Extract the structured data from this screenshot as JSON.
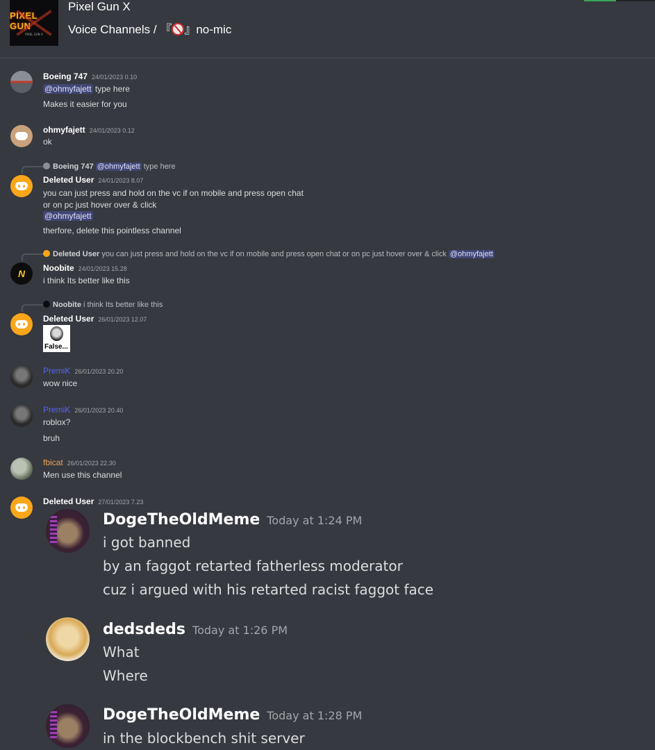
{
  "header": {
    "server_name": "Pixel Gun X",
    "breadcrumb_category": "Voice Channels /",
    "channel_prefix": "『",
    "channel_suffix": "』no-mic",
    "server_icon_text": "PIXEL GUN",
    "server_icon_subtext": "PIXEL GUN X"
  },
  "messages": [
    {
      "author": "Boeing 747",
      "timestamp": "24/01/2023 0.10",
      "mention": "@ohmyfajett",
      "line1_rest": " type here",
      "line2": "Makes it easier for you"
    },
    {
      "author": "ohmyfajett",
      "timestamp": "24/01/2023 0.12",
      "line1": "ok"
    },
    {
      "reply_author": "Boeing 747",
      "reply_mention": "@ohmyfajett",
      "reply_text": " type here",
      "author": "Deleted User",
      "timestamp": "24/01/2023 8.07",
      "line1": "you can just press and hold on the vc if on mobile and press open chat",
      "line2": "or on pc just hover over & click",
      "mention": "@ohmyfajett",
      "line3": "therfore, delete this pointless channel"
    },
    {
      "reply_author": "Deleted User",
      "reply_text": " you can just press and hold on the vc if on mobile and press open chat or on pc just hover over & click ",
      "reply_mention": "@ohmyfajett",
      "author": "Noobite",
      "timestamp": "24/01/2023 15.28",
      "line1": "i think Its better like this",
      "avatar_letter": "N"
    },
    {
      "reply_author": "Noobite",
      "reply_text": " i think Its better like this",
      "author": "Deleted User",
      "timestamp": "26/01/2023 12.07",
      "image_caption": "False..."
    },
    {
      "author": "PremiK",
      "timestamp": "26/01/2023 20.20",
      "line1": "wow nice"
    },
    {
      "author": "PremiK",
      "timestamp": "26/01/2023 20.40",
      "line1": "roblox?",
      "line2": "bruh"
    },
    {
      "author": "fbicat",
      "timestamp": "26/01/2023 22.30",
      "line1": "Men use this channel"
    },
    {
      "author": "Deleted User",
      "timestamp": "27/01/2023 7.23"
    }
  ],
  "screenshot": [
    {
      "author": "DogeTheOldMeme",
      "timestamp": "Today at 1:24 PM",
      "lines": [
        "i got banned",
        "by an faggot retarted fatherless moderator",
        "cuz i argued with his retarted racist faggot face"
      ]
    },
    {
      "author": "dedsdeds",
      "timestamp": "Today at 1:26 PM",
      "lines": [
        "What",
        "Where"
      ]
    },
    {
      "author": "DogeTheOldMeme",
      "timestamp": "Today at 1:28 PM",
      "lines": [
        "in the blockbench shit server"
      ]
    }
  ],
  "colors": {
    "background": "#36393f",
    "premik_name": "#5865f2",
    "fbicat_name": "#e8a45a",
    "deleted_user_avatar": "#faa61a",
    "mention_bg": "#414675"
  },
  "icons": {
    "channel_icon": "no-mobile-icon",
    "default_avatar": "discord-logo-icon"
  }
}
